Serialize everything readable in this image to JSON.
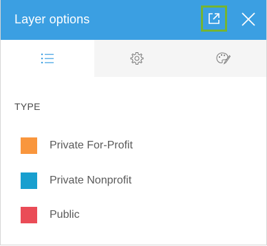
{
  "header": {
    "title": "Layer options",
    "popout_icon": "popout-icon",
    "close_icon": "close-icon",
    "background": "#3b9fe2",
    "highlight": "#75b431"
  },
  "tabs": [
    {
      "icon": "list-icon",
      "active": true
    },
    {
      "icon": "gear-icon",
      "active": false
    },
    {
      "icon": "palette-icon",
      "active": false
    }
  ],
  "legend": {
    "section_label": "TYPE",
    "items": [
      {
        "label": "Private For-Profit",
        "color": "#f9963d"
      },
      {
        "label": "Private Nonprofit",
        "color": "#189fcf"
      },
      {
        "label": "Public",
        "color": "#ea4c57"
      }
    ]
  }
}
